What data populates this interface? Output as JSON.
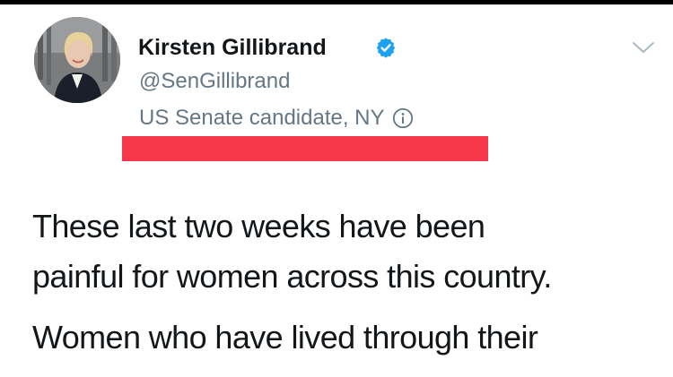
{
  "tweet": {
    "author": {
      "display_name": "Kirsten Gillibrand",
      "handle": "@SenGillibrand",
      "verified": true,
      "label": "US Senate candidate, NY"
    },
    "body_lines": [
      "These last two weeks have been",
      "painful for women across this country.",
      "Women who have lived through their"
    ]
  },
  "icons": {
    "verified": "verified-badge-icon",
    "info": "info-icon",
    "menu": "chevron-down-icon"
  },
  "colors": {
    "verified_blue": "#1da1f2",
    "secondary_text": "#657786",
    "highlight": "#f7364c"
  }
}
